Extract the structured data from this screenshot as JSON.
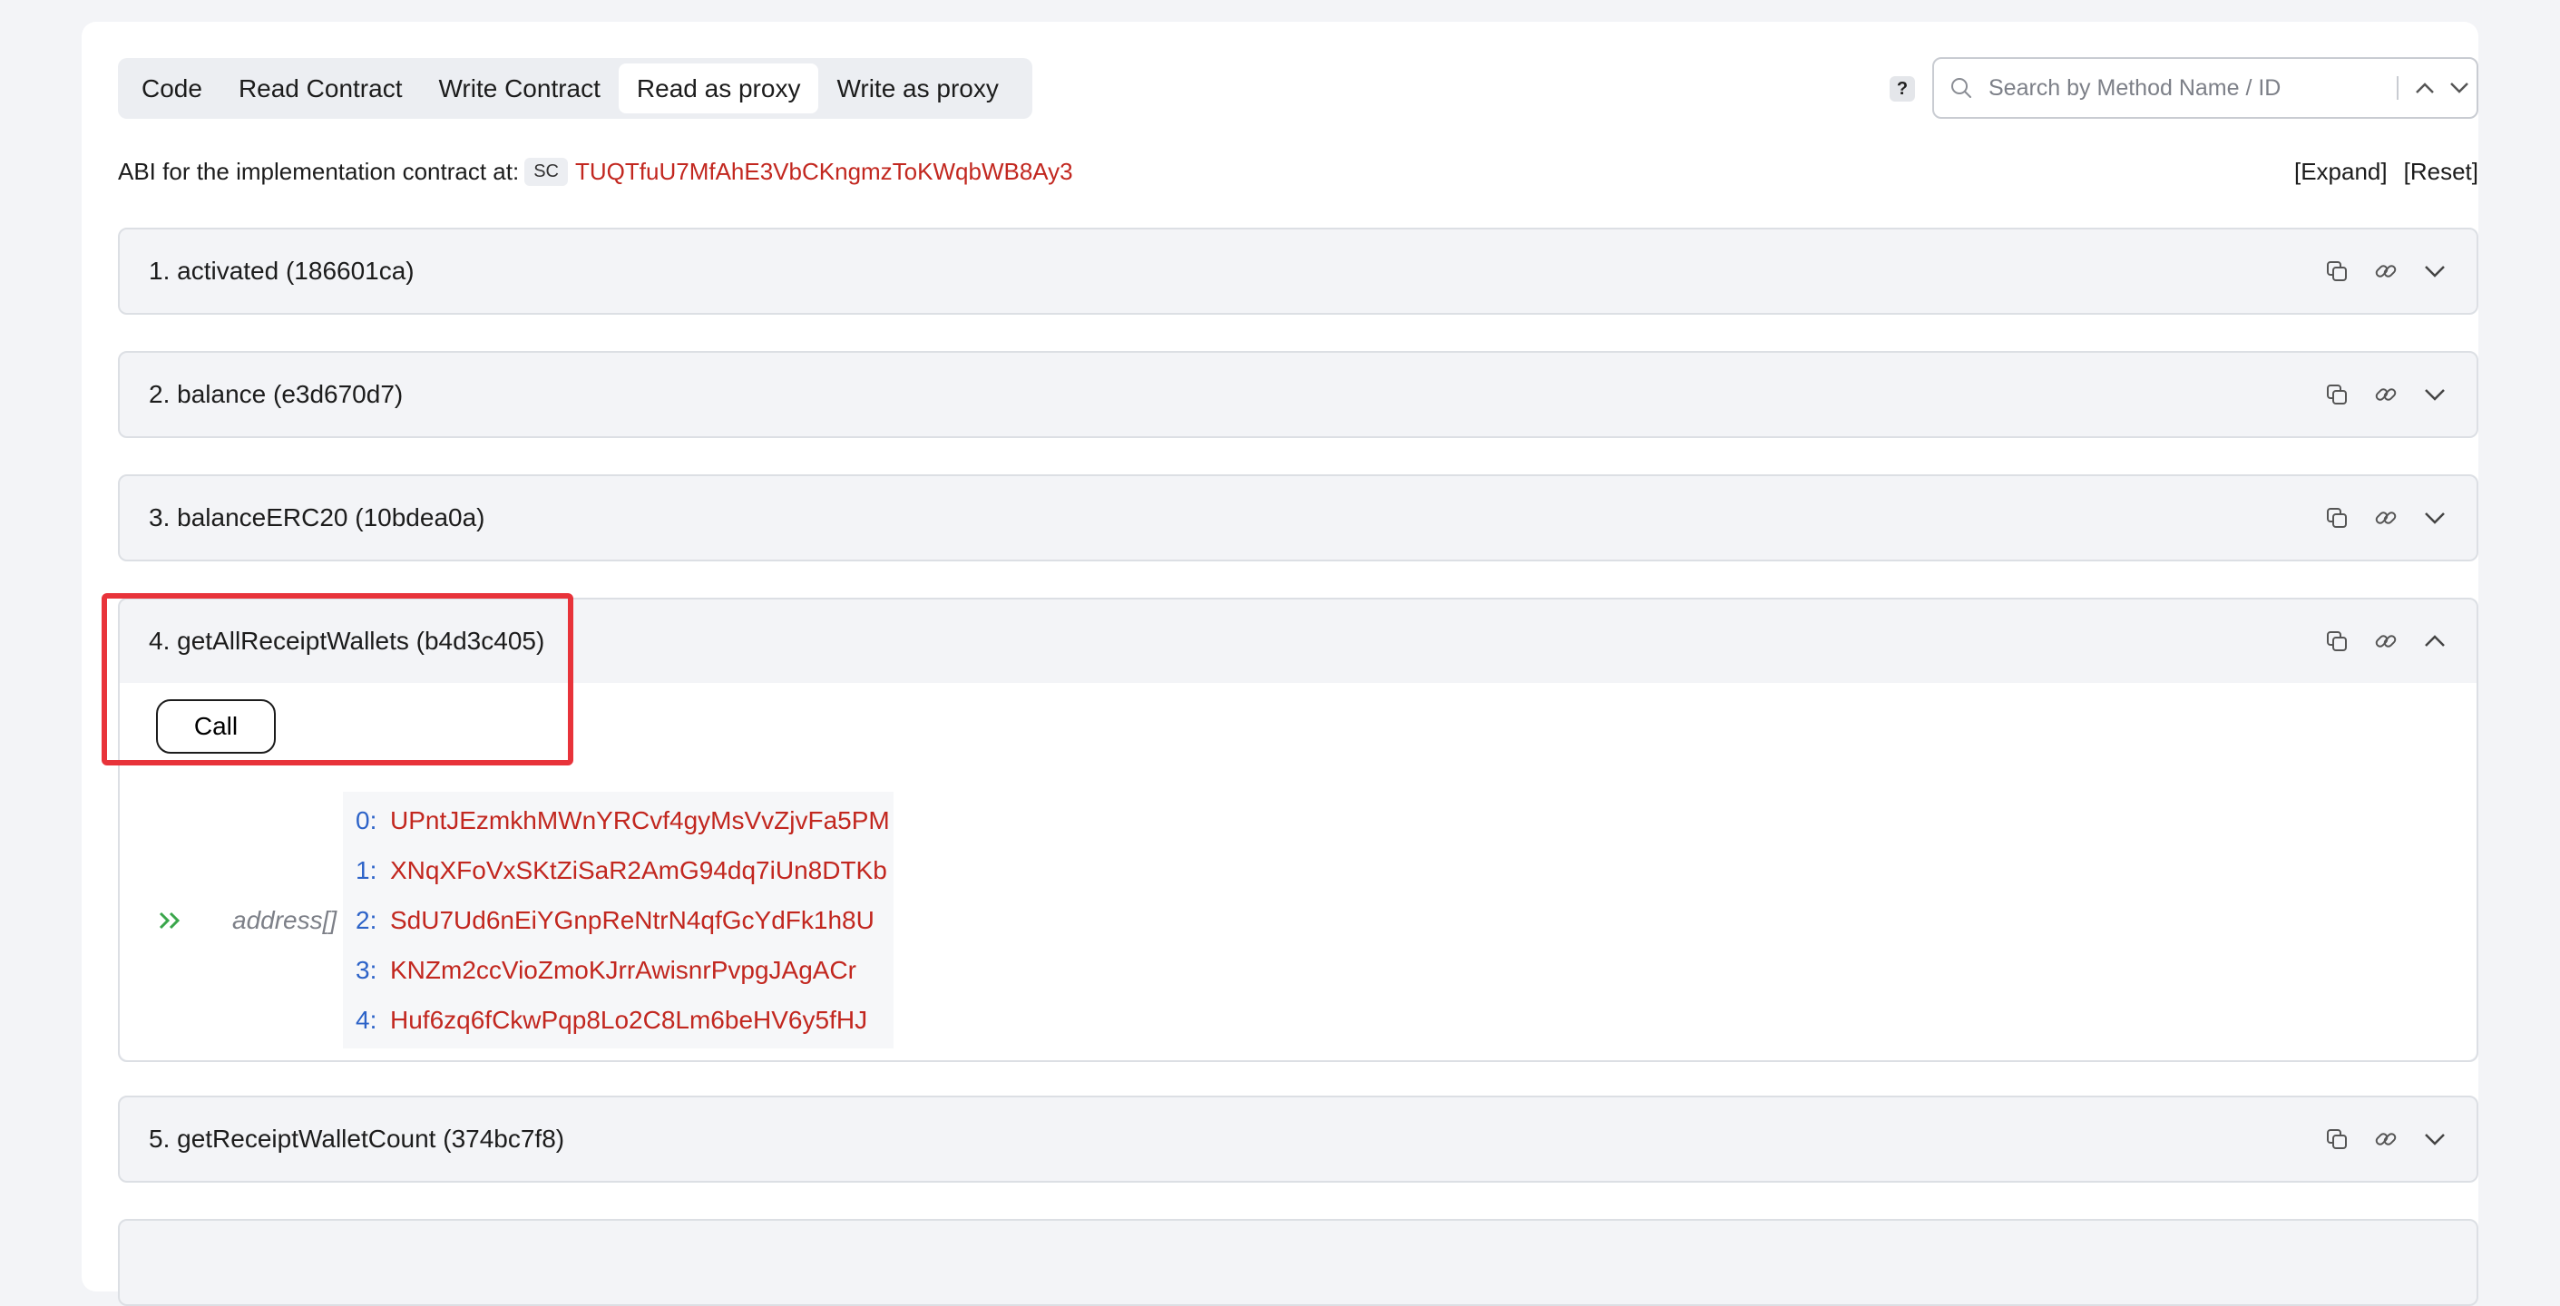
{
  "tabs": [
    {
      "label": "Code",
      "active": false
    },
    {
      "label": "Read Contract",
      "active": false
    },
    {
      "label": "Write Contract",
      "active": false
    },
    {
      "label": "Read as proxy",
      "active": true
    },
    {
      "label": "Write as proxy",
      "active": false
    }
  ],
  "help_label": "?",
  "search": {
    "placeholder": "Search by Method Name / ID",
    "icon": "search-icon"
  },
  "abi": {
    "prefix": "ABI for the implementation contract at:",
    "badge": "SC",
    "address": "TUQTfuU7MfAhE3VbCKngmzToKWqbWB8Ay3"
  },
  "controls": {
    "expand": "[Expand]",
    "reset": "[Reset]"
  },
  "methods": [
    {
      "title": "1. activated (186601ca)",
      "expanded": false
    },
    {
      "title": "2. balance (e3d670d7)",
      "expanded": false
    },
    {
      "title": "3. balanceERC20 (10bdea0a)",
      "expanded": false
    },
    {
      "title": "4. getAllReceiptWallets (b4d3c405)",
      "expanded": true
    },
    {
      "title": "5. getReceiptWalletCount (374bc7f8)",
      "expanded": false
    }
  ],
  "call_label": "Call",
  "result": {
    "type": "address[]",
    "items": [
      {
        "index": "0:",
        "value": "UPntJEzmkhMWnYRCvf4gyMsVvZjvFa5PM"
      },
      {
        "index": "1:",
        "value": "XNqXFoVxSKtZiSaR2AmG94dq7iUn8DTKb"
      },
      {
        "index": "2:",
        "value": "SdU7Ud6nEiYGnpReNtrN4qfGcYdFk1h8U"
      },
      {
        "index": "3:",
        "value": "KNZm2ccVioZmoKJrrAwisnrPvpgJAgACr"
      },
      {
        "index": "4:",
        "value": "Huf6zq6fCkwPqp8Lo2C8Lm6beHV6y5fHJ"
      }
    ]
  },
  "colors": {
    "address": "#c2271f",
    "index": "#2d63c8",
    "arrow": "#3aa64b",
    "highlight": "#e8333a"
  }
}
